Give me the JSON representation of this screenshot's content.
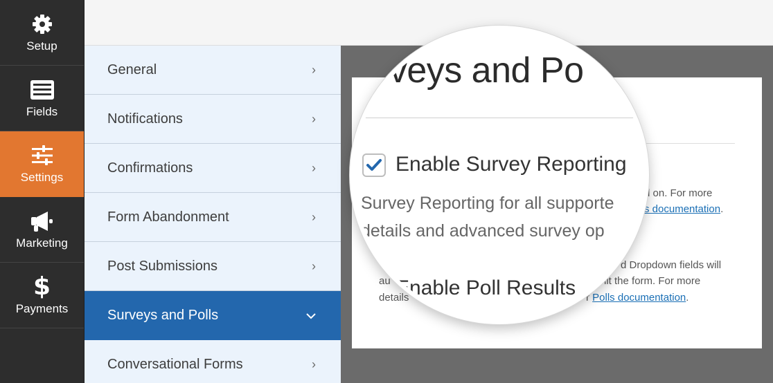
{
  "rail": {
    "items": [
      {
        "label": "Setup",
        "icon": "gear-icon"
      },
      {
        "label": "Fields",
        "icon": "list-icon"
      },
      {
        "label": "Settings",
        "icon": "sliders-icon"
      },
      {
        "label": "Marketing",
        "icon": "megaphone-icon"
      },
      {
        "label": "Payments",
        "icon": "dollar-icon"
      }
    ],
    "active_index": 2
  },
  "settings_nav": {
    "items": [
      {
        "label": "General"
      },
      {
        "label": "Notifications"
      },
      {
        "label": "Confirmations"
      },
      {
        "label": "Form Abandonment"
      },
      {
        "label": "Post Submissions"
      },
      {
        "label": "Surveys and Polls"
      },
      {
        "label": "Conversational Forms"
      }
    ],
    "active_index": 5
  },
  "panel": {
    "title": "rveys and Po",
    "survey_reporting": {
      "label": "Enable Survey Reporting",
      "checked": true,
      "desc_line1": "Survey Reporting for all supporte",
      "desc_line2": "details and advanced survey op",
      "side_text": "d on. For more",
      "side_link": "s documentation",
      "side_link_suffix": "."
    },
    "poll_results": {
      "label": "Enable Poll Results",
      "line1": "d Dropdown fields will",
      "line2_prefix": "au",
      "line2_suffix": "nit the form. For more",
      "line3_prefix": "details",
      "line3_mid": "r",
      "link": "Polls documentation",
      "link_suffix": "."
    }
  },
  "colors": {
    "rail_bg": "#2d2d2d",
    "rail_active": "#e27730",
    "subnav_bg": "#ebf3fc",
    "subnav_active": "#2367ad",
    "checkbox_check": "#2367ad",
    "link": "#1a6fb5"
  }
}
